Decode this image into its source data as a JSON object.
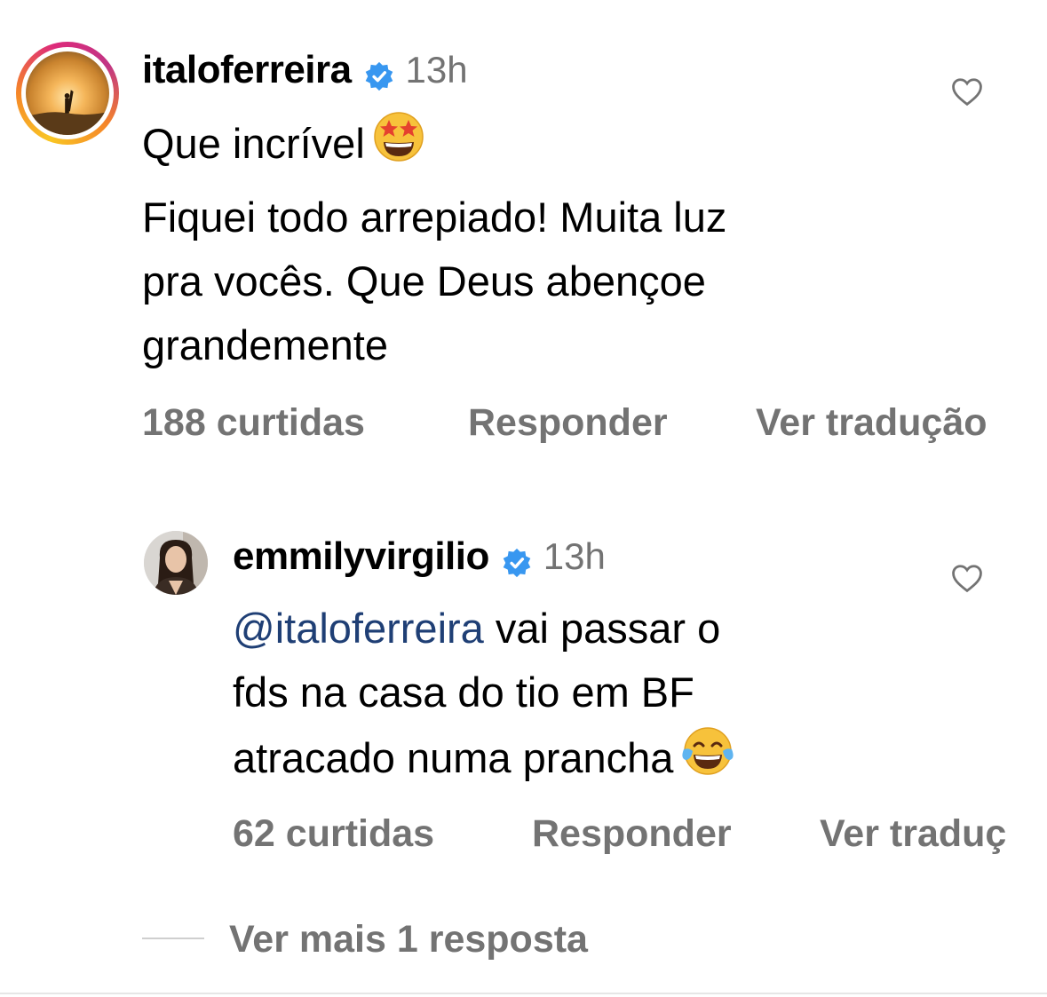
{
  "comments": [
    {
      "username": "italoferreira",
      "time": "13h",
      "lines": [
        "Que incrível",
        "Fiquei todo arrepiado! Muita luz",
        "pra vocês. Que Deus abençoe",
        "grandemente"
      ],
      "emoji": "star-struck",
      "likes": "188 curtidas",
      "reply_label": "Responder",
      "translate_label": "Ver tradução"
    },
    {
      "username": "emmilyvirgilio",
      "time": "13h",
      "mention": "@italoferreira",
      "lines": [
        " vai passar o",
        "fds na casa do tio em BF",
        "atracado numa prancha"
      ],
      "emoji": "face-with-tears-of-joy",
      "likes": "62 curtidas",
      "reply_label": "Responder",
      "translate_label": "Ver traduç"
    }
  ],
  "more_replies_label": "Ver mais 1 resposta",
  "colors": {
    "verified": "#3897f0",
    "secondary_text": "#737373",
    "mention": "#1f3f75"
  }
}
